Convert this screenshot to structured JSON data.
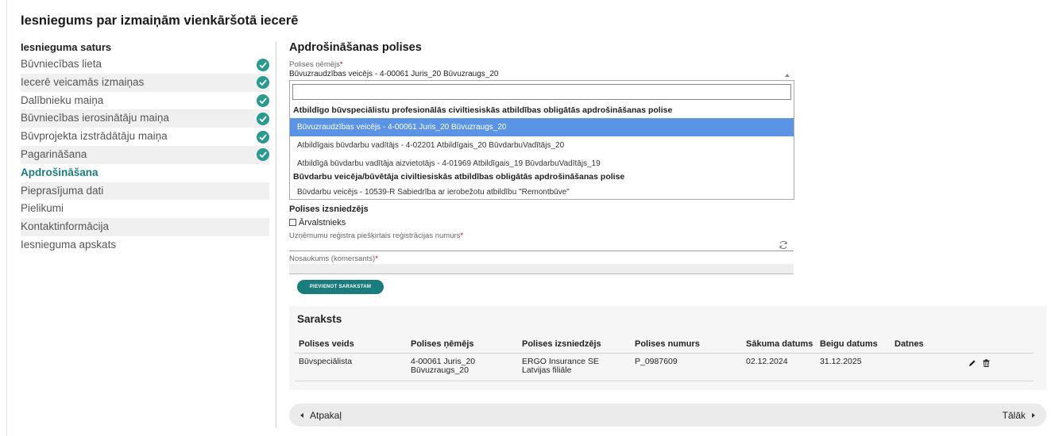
{
  "page": {
    "title": "Iesniegums par izmaiņām vienkāršotā iecerē"
  },
  "sidebar": {
    "heading": "Iesnieguma saturs",
    "items": [
      {
        "label": "Būvniecības lieta",
        "done": true
      },
      {
        "label": "Iecerē veicamās izmaiņas",
        "done": true
      },
      {
        "label": "Dalībnieku maiņa",
        "done": true
      },
      {
        "label": "Būvniecības ierosinātāju maiņa",
        "done": true
      },
      {
        "label": "Būvprojekta izstrādātāju maiņa",
        "done": true
      },
      {
        "label": "Pagarināšana",
        "done": true
      },
      {
        "label": "Apdrošināšana",
        "active": true
      },
      {
        "label": "Pieprasījuma dati"
      },
      {
        "label": "Pielikumi"
      },
      {
        "label": "Kontaktinformācija"
      },
      {
        "label": "Iesnieguma apskats"
      }
    ]
  },
  "main": {
    "section_title": "Apdrošināšanas polises",
    "insured_label": "Polises ņēmējs",
    "insured_value": "Būvuzraudzības veicējs - 4-00061 Juris_20 Būvuzraugs_20",
    "dropdown": {
      "search_value": "",
      "group1": "Atbildīgo būvspeciālistu profesionālās civiltiesiskās atbildības obligātās apdrošināšanas polise",
      "group1_options": [
        "Būvuzraudzības veicējs - 4-00061 Juris_20 Būvuzraugs_20",
        "Atbildīgais būvdarbu vadītājs - 4-02201 Atbildīgais_20 BūvdarbuVadītājs_20",
        "Atbildīgā būvdarbu vadītāja aizvietotājs - 4-01969 Atbildīgais_19 BūvdarbuVadītājs_19"
      ],
      "group2": "Būvdarbu veicēja/būvētāja civiltiesiskās atbildības obligātās apdrošināšanas polise",
      "group2_options": [
        "Būvdarbu veicējs - 10539-R Sabiedrība ar ierobežotu atbildību \"Remontbūve\""
      ]
    },
    "issuer_heading": "Polises izsniedzējs",
    "foreign_label": "Ārvalstnieks",
    "reg_number_label": "Uzņēmumu reģistra piešķirtais reģistrācijas numurs",
    "name_label": "Nosaukums (komersants)",
    "add_button": "PIEVIENOT SARAKSTAM",
    "required_mark": "*"
  },
  "list": {
    "title": "Saraksts",
    "columns": [
      "Polises veids",
      "Polises ņēmējs",
      "Polises izsniedzējs",
      "Polises numurs",
      "Sākuma datums",
      "Beigu datums",
      "Datnes"
    ],
    "rows": [
      {
        "type": "Būvspeciālista",
        "insured_line1": "4-00061 Juris_20",
        "insured_line2": "Būvuzraugs_20",
        "issuer_line1": "ERGO Insurance SE",
        "issuer_line2": "Latvijas filiāle",
        "number": "P_0987609",
        "start": "02.12.2024",
        "end": "31.12.2025",
        "files": ""
      }
    ]
  },
  "nav": {
    "back": "Atpakaļ",
    "next": "Tālāk"
  },
  "colors": {
    "accent": "#1b7c7e",
    "check": "#2a9a8e",
    "selected_option": "#5b94e5"
  }
}
